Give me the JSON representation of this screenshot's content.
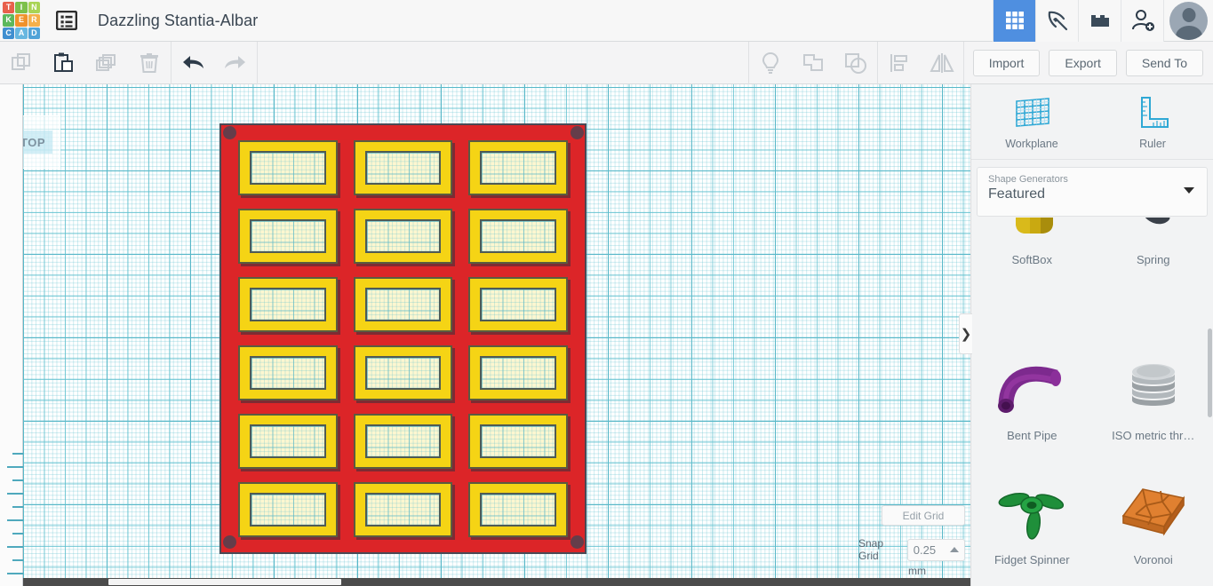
{
  "app": {
    "title": "Dazzling Stantia-Albar",
    "logo_tiles": [
      {
        "letter": "T",
        "color": "#e8604c"
      },
      {
        "letter": "I",
        "color": "#7cc04a"
      },
      {
        "letter": "N",
        "color": "#a9d455"
      },
      {
        "letter": "K",
        "color": "#5cb85c"
      },
      {
        "letter": "E",
        "color": "#f0922b"
      },
      {
        "letter": "R",
        "color": "#f5b04a"
      },
      {
        "letter": "C",
        "color": "#3f8fd0"
      },
      {
        "letter": "A",
        "color": "#67b7e0"
      },
      {
        "letter": "D",
        "color": "#4fa3d8"
      }
    ],
    "menu_icon": "list-menu-icon",
    "top_right_buttons": [
      {
        "name": "apps-grid-icon",
        "active": true
      },
      {
        "name": "design-tool-icon",
        "active": false
      },
      {
        "name": "blocks-icon",
        "active": false
      },
      {
        "name": "invite-person-icon",
        "active": false
      }
    ],
    "avatar": "user-avatar"
  },
  "toolbar": {
    "left_icons": [
      {
        "name": "copy-icon",
        "enabled": false
      },
      {
        "name": "paste-icon",
        "enabled": true
      },
      {
        "name": "duplicate-icon",
        "enabled": false
      },
      {
        "name": "delete-icon",
        "enabled": false
      }
    ],
    "history_icons": [
      {
        "name": "undo-icon",
        "enabled": true
      },
      {
        "name": "redo-icon",
        "enabled": false
      }
    ],
    "shape_icons": [
      {
        "name": "lightbulb-icon",
        "enabled": false
      },
      {
        "name": "group-icon",
        "enabled": false
      },
      {
        "name": "ungroup-icon",
        "enabled": false
      }
    ],
    "align_icons": [
      {
        "name": "align-icon",
        "enabled": false
      },
      {
        "name": "mirror-icon",
        "enabled": false
      }
    ],
    "import_label": "Import",
    "export_label": "Export",
    "send_to_label": "Send To"
  },
  "canvas": {
    "view_cube_label": "TOP",
    "nav_buttons": [
      {
        "name": "home-view-button"
      },
      {
        "name": "fit-view-button"
      },
      {
        "name": "zoom-in-button"
      },
      {
        "name": "zoom-out-button"
      },
      {
        "name": "ortho-perspective-button"
      }
    ],
    "model": {
      "name": "selected-shape-grid-plate",
      "base_color": "#dc2528",
      "cell_color": "#f5d415",
      "rows": 6,
      "columns": 3
    },
    "edit_grid_label": "Edit Grid",
    "snap_grid_label": "Snap Grid",
    "snap_grid_value": "0.25",
    "snap_grid_unit": "mm"
  },
  "right_panel": {
    "tools": [
      {
        "label": "Workplane",
        "icon": "workplane-icon"
      },
      {
        "label": "Ruler",
        "icon": "ruler-icon"
      }
    ],
    "shape_generators_label": "Shape Generators",
    "shape_generators_value": "Featured",
    "shapes": [
      {
        "label": "SoftBox",
        "icon": "softbox-shape-icon",
        "color": "#c9a911"
      },
      {
        "label": "Spring",
        "icon": "spring-shape-icon",
        "color": "#3a4049"
      },
      {
        "label": "Bent Pipe",
        "icon": "bent-pipe-shape-icon",
        "color": "#7d2a8e"
      },
      {
        "label": "ISO metric thr…",
        "icon": "iso-metric-thread-shape-icon",
        "color": "#b9bcbe"
      },
      {
        "label": "Fidget Spinner",
        "icon": "fidget-spinner-shape-icon",
        "color": "#1f8f3a"
      },
      {
        "label": "Voronoi",
        "icon": "voronoi-shape-icon",
        "color": "#e08030"
      }
    ],
    "collapse_tab_glyph": "❯"
  }
}
